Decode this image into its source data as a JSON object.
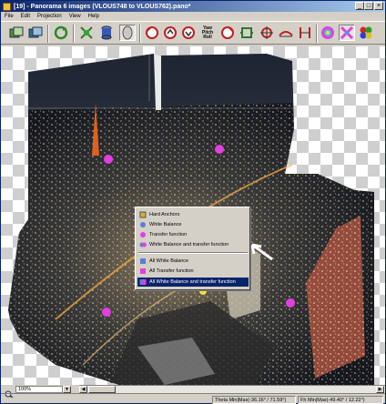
{
  "window": {
    "title": "[19] - Panorama 6 images (VLOUS748 to VLOUS762).pano*",
    "minimize_label": "_",
    "maximize_label": "□",
    "close_label": "×"
  },
  "menu": {
    "items": [
      {
        "label": "File"
      },
      {
        "label": "Edit"
      },
      {
        "label": "Projection"
      },
      {
        "label": "View"
      },
      {
        "label": "Help"
      }
    ]
  },
  "toolbar": {
    "yaw_pitch_roll_label": "Yaw\nPitch\nRoll"
  },
  "context_menu": {
    "items": [
      {
        "label": "Hard Anchors",
        "icon": "anchor-icon"
      },
      {
        "label": "White Balance",
        "icon": "white-balance-icon"
      },
      {
        "label": "Transfer function",
        "icon": "transfer-function-icon"
      },
      {
        "label": "White Balance and transfer function",
        "icon": "white-balance-transfer-icon"
      },
      {
        "label": "All White Balance",
        "icon": "all-white-balance-icon"
      },
      {
        "label": "All Transfer function",
        "icon": "all-transfer-function-icon"
      },
      {
        "label": "All White Balance and transfer function",
        "icon": "all-white-balance-transfer-icon",
        "selected": true
      }
    ]
  },
  "zoom": {
    "value": "100%"
  },
  "status": {
    "theta": "Theta Min|Max(-36.16° / 71.59°)",
    "fov": "Fh Min|Max(-49.40° / 12.22°)"
  },
  "colors": {
    "title_start": "#0a246a",
    "title_end": "#a6caf0",
    "menu_highlight": "#0a246a",
    "chrome": "#d4d0c8"
  }
}
